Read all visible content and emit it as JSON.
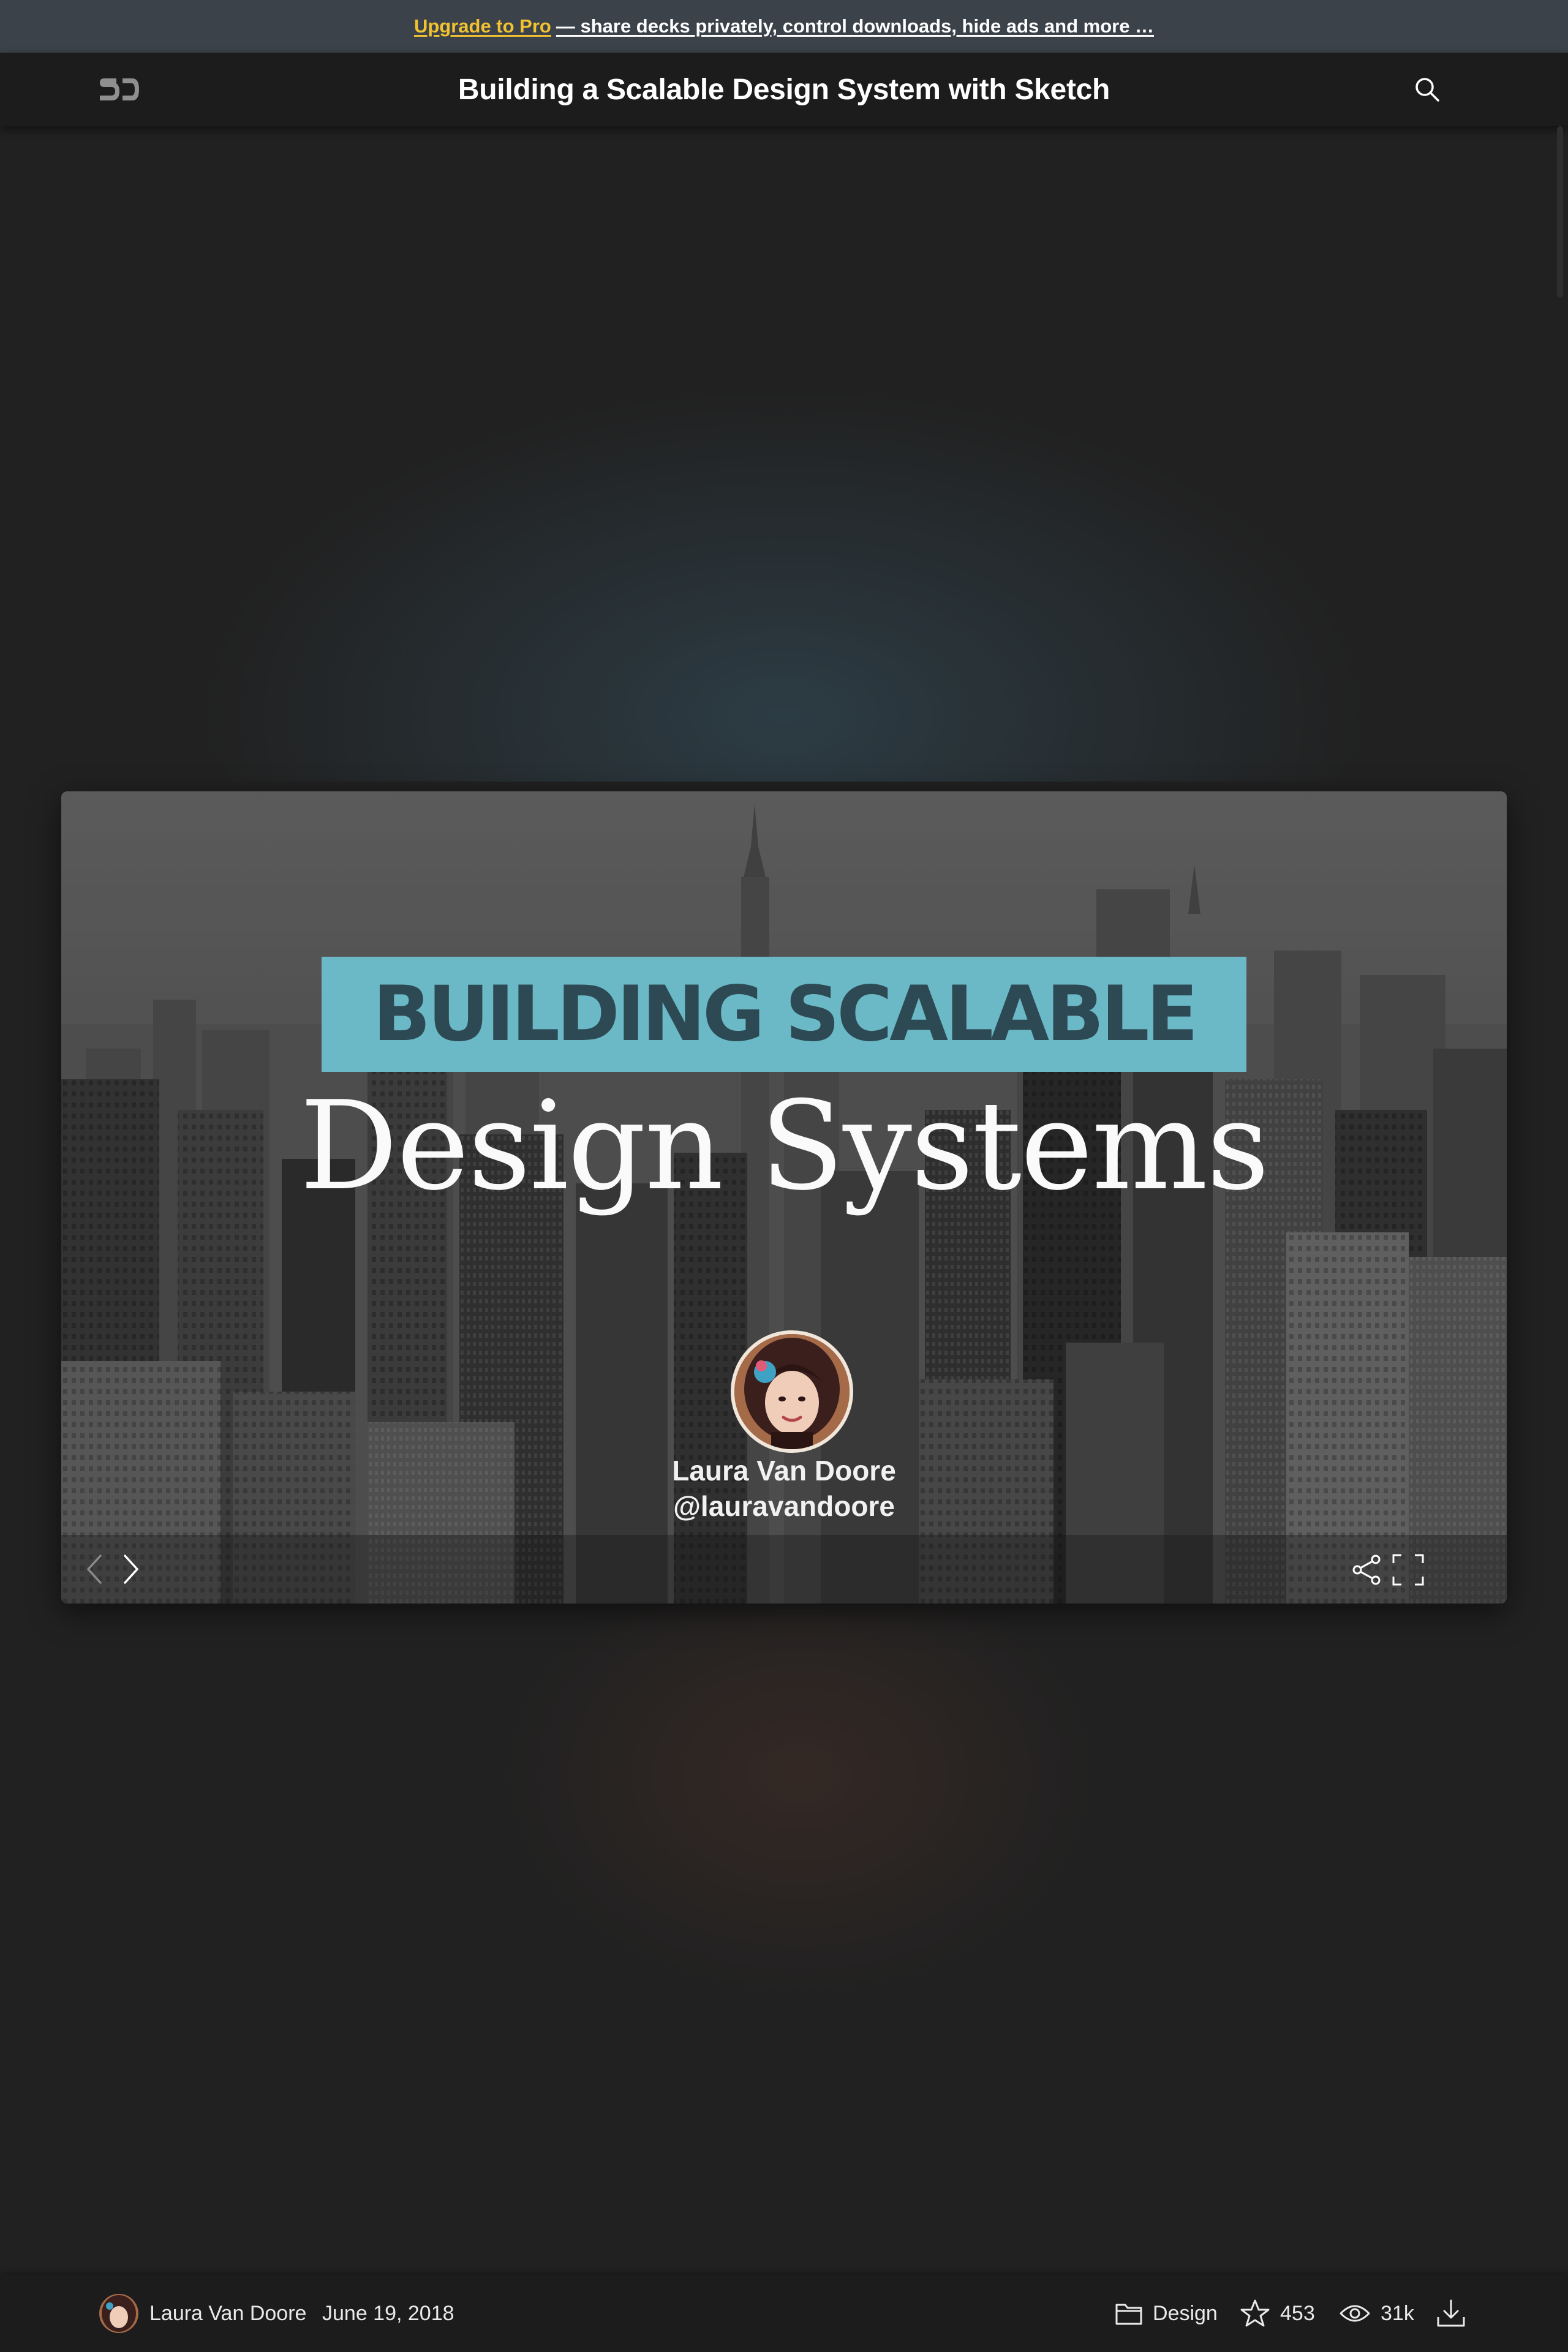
{
  "promo": {
    "upgrade_label": "Upgrade to Pro",
    "message": " — share decks privately, control downloads, hide ads and more …"
  },
  "header": {
    "logo_text": "SD",
    "title": "Building a Scalable Design System with Sketch",
    "search_icon": "search-icon"
  },
  "slide": {
    "band_text": "BUILDING SCALABLE",
    "heading": "Design Systems",
    "speaker_name": "Laura Van Doore",
    "speaker_handle": "@lauravandoore",
    "colors": {
      "band": "#6bb9c6",
      "band_text": "#2d4a54"
    }
  },
  "player_controls": {
    "prev_icon": "chevron-left-icon",
    "next_icon": "chevron-right-icon",
    "share_icon": "share-icon",
    "fullscreen_icon": "fullscreen-icon"
  },
  "footer": {
    "author": "Laura Van Doore",
    "date": "June 19, 2018",
    "category": "Design",
    "stars": "453",
    "views": "31k",
    "icons": [
      "folder-icon",
      "star-icon",
      "eye-icon",
      "download-icon"
    ]
  },
  "colors": {
    "promo_bg": "#3b424a",
    "nav_bg": "#1c1c1c",
    "page_bg": "#212121",
    "upgrade_link": "#f2c230"
  }
}
